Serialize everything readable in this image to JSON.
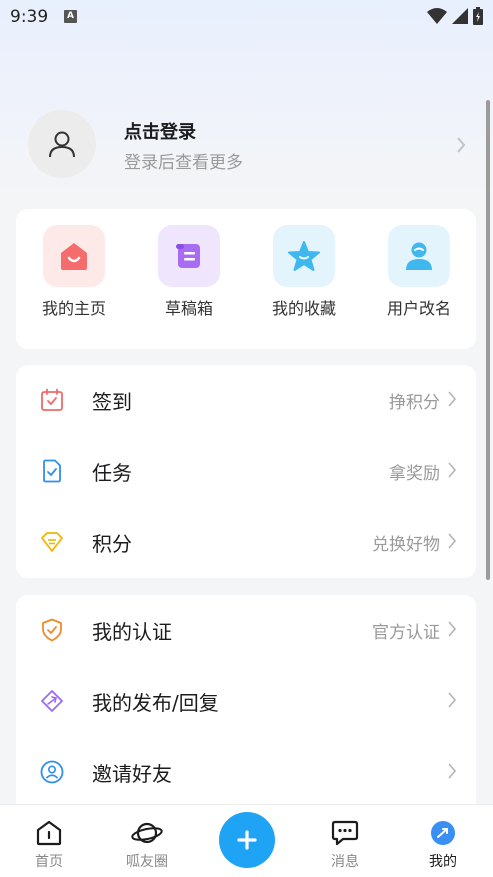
{
  "status": {
    "time": "9:39",
    "notification": "A"
  },
  "profile": {
    "title": "点击登录",
    "subtitle": "登录后查看更多"
  },
  "shortcuts": [
    {
      "label": "我的主页",
      "icon": "home-icon",
      "color": "#f46c6c"
    },
    {
      "label": "草稿箱",
      "icon": "scroll-icon",
      "color": "#a86cf2"
    },
    {
      "label": "我的收藏",
      "icon": "star-icon",
      "color": "#3fb8f0"
    },
    {
      "label": "用户改名",
      "icon": "user-icon",
      "color": "#3fb8f0"
    }
  ],
  "group1": [
    {
      "label": "签到",
      "sub": "挣积分",
      "icon": "calendar-check-icon",
      "color": "#f06a6a"
    },
    {
      "label": "任务",
      "sub": "拿奖励",
      "icon": "task-icon",
      "color": "#2f8ff0"
    },
    {
      "label": "积分",
      "sub": "兑换好物",
      "icon": "diamond-icon",
      "color": "#f5b400"
    }
  ],
  "group2": [
    {
      "label": "我的认证",
      "sub": "官方认证",
      "icon": "shield-check-icon",
      "color": "#f08a2a"
    },
    {
      "label": "我的发布/回复",
      "sub": "",
      "icon": "send-icon",
      "color": "#9a6cf2"
    },
    {
      "label": "邀请好友",
      "sub": "",
      "icon": "invite-icon",
      "color": "#2f8ff0"
    }
  ],
  "tabs": [
    {
      "label": "首页",
      "icon": "home-tab-icon"
    },
    {
      "label": "呱友圈",
      "icon": "planet-icon"
    },
    {
      "label": "消息",
      "icon": "message-icon"
    },
    {
      "label": "我的",
      "icon": "me-icon"
    }
  ],
  "fab": {
    "icon": "plus-icon"
  },
  "colors": {
    "accent": "#1fa4f5",
    "background": "#f4f5f7"
  }
}
